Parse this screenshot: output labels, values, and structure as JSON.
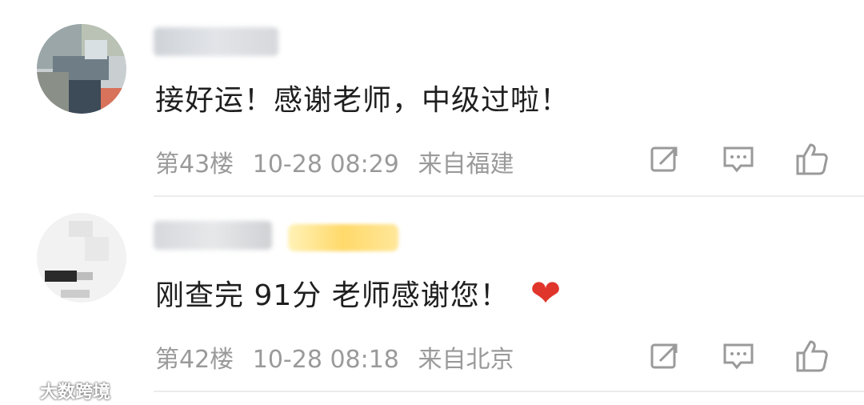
{
  "comments": [
    {
      "text": "接好运！感谢老师，中级过啦！",
      "floor": "第43楼",
      "time": "10-28 08:29",
      "location": "来自福建",
      "actions": [
        "share-icon",
        "reply-icon",
        "like-icon"
      ]
    },
    {
      "text": "刚查完  91分 老师感谢您！",
      "emoji": "❤",
      "floor": "第42楼",
      "time": "10-28 08:18",
      "location": "来自北京",
      "actions": [
        "share-icon",
        "reply-icon",
        "like-icon"
      ]
    }
  ],
  "watermark": {
    "text": "大数跨境"
  },
  "colors": {
    "meta": "#9a9a9a",
    "text": "#1f1f1f",
    "heart": "#e0352b",
    "divider": "#ececec"
  }
}
